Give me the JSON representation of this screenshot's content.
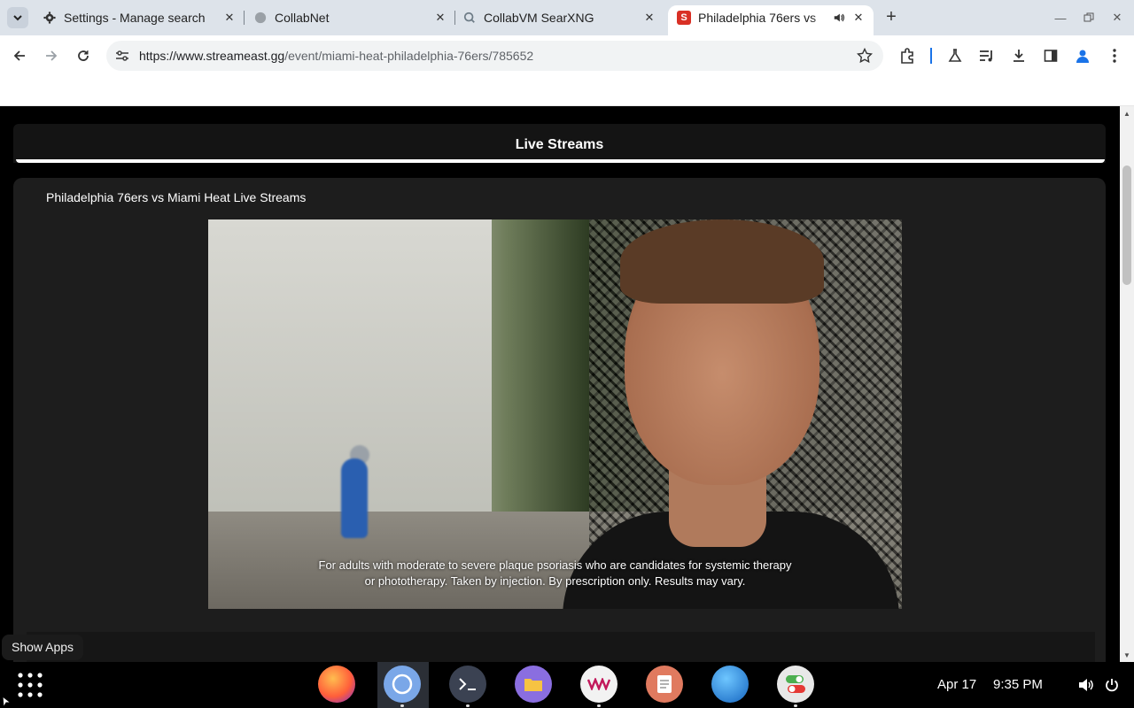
{
  "browser": {
    "tabs": [
      {
        "title": "Settings - Manage search",
        "favicon": "gear-icon"
      },
      {
        "title": "CollabNet",
        "favicon": "globe-icon"
      },
      {
        "title": "CollabVM SearXNG",
        "favicon": "searxng-icon"
      },
      {
        "title": "Philadelphia 76ers vs",
        "favicon": "streameast-icon",
        "favicon_letter": "S",
        "active": true,
        "audio": true
      }
    ],
    "url_host": "https://www.streameast.gg",
    "url_path": "/event/miami-heat-philadelphia-76ers/785652",
    "accent": "#1a73e8"
  },
  "page": {
    "header_title": "Live Streams",
    "card_title": "Philadelphia 76ers vs Miami Heat Live Streams",
    "video": {
      "caption_line1": "For adults with moderate to severe plaque psoriasis who are candidates for systemic therapy",
      "caption_line2": "or phototherapy. Taken by injection. By prescription only. Results may vary."
    }
  },
  "tooltip": "Show Apps",
  "shelf": {
    "apps": [
      "firefox-icon",
      "chromium-icon",
      "terminal-icon",
      "files-icon",
      "vm-icon",
      "text-editor-icon",
      "web-browser-icon",
      "toggle-settings-icon"
    ],
    "date": "Apr 17",
    "time": "9:35 PM"
  }
}
